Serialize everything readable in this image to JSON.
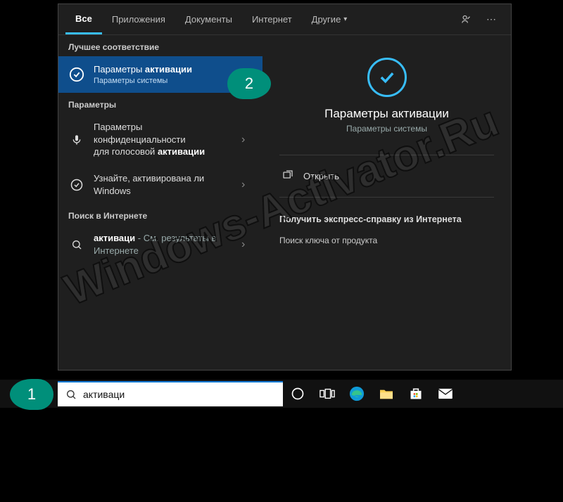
{
  "tabs": {
    "all": "Все",
    "apps": "Приложения",
    "docs": "Документы",
    "web": "Интернет",
    "more": "Другие"
  },
  "left": {
    "best_match_title": "Лучшее соответствие",
    "best_match": {
      "title_pre": "Параметры ",
      "title_bold": "активации",
      "sub": "Параметры системы"
    },
    "params_title": "Параметры",
    "privacy": {
      "line1": "Параметры конфиденциальности",
      "line2_pre": "для голосовой ",
      "line2_bold": "активации"
    },
    "check": "Узнайте, активирована ли Windows",
    "web_title": "Поиск в Интернете",
    "web_item_pre": "активаци",
    "web_item_post": " - См. результаты в Интернете"
  },
  "right": {
    "title": "Параметры активации",
    "sub": "Параметры системы",
    "open": "Открыть",
    "help_title": "Получить экспресс-справку из Интернета",
    "help_item": "Поиск ключа от продукта"
  },
  "search": {
    "value": "активаци"
  },
  "watermark": "Windows-Activator.Ru",
  "callouts": {
    "one": "1",
    "two": "2"
  }
}
